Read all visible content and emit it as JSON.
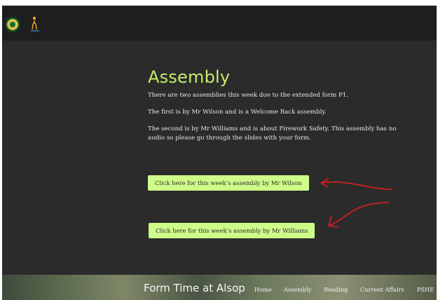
{
  "header": {
    "logo_crest_icon": "school-crest-icon",
    "logo_figure_icon": "figure-logo-icon"
  },
  "main": {
    "title": "Assembly",
    "paragraphs": [
      "There are two assemblies this week due to the extended form P1.",
      "The first is by Mr Wilson and is a Welcome Back assembly.",
      "The second is by Mr Williams and is about Firework Safety. This assembly has no audio so please go through the slides with your form."
    ],
    "buttons": [
      "Click here for this week’s assembly by Mr Wilson",
      "Click here for this week’s assembly by Mr Williams"
    ]
  },
  "footer": {
    "site_title": "Form Time at Alsop",
    "nav": [
      "Home",
      "Assembly",
      "Reading",
      "Current Affairs",
      "PSHE"
    ]
  },
  "colors": {
    "accent": "#c4ee6a",
    "button_bg": "#cffb89",
    "background": "#2b2b2b",
    "annotation_arrow": "#d21f1f"
  }
}
